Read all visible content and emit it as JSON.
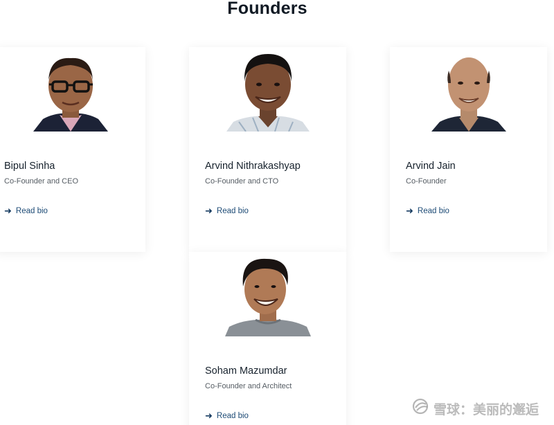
{
  "section": {
    "title": "Founders"
  },
  "founders": [
    {
      "name": "Bipul Sinha",
      "role": "Co-Founder and CEO",
      "link_label": "Read bio",
      "photo_icon": "person-portrait-glasses"
    },
    {
      "name": "Arvind Nithrakashyap",
      "role": "Co-Founder and CTO",
      "link_label": "Read bio",
      "photo_icon": "person-portrait"
    },
    {
      "name": "Arvind Jain",
      "role": "Co-Founder",
      "link_label": "Read bio",
      "photo_icon": "person-portrait"
    },
    {
      "name": "Soham Mazumdar",
      "role": "Co-Founder and Architect",
      "link_label": "Read bio",
      "photo_icon": "person-portrait"
    }
  ],
  "watermark": {
    "text": "雪球：美丽的邂逅"
  },
  "colors": {
    "link": "#1c4a75",
    "title": "#111a24",
    "role": "#555c63"
  }
}
